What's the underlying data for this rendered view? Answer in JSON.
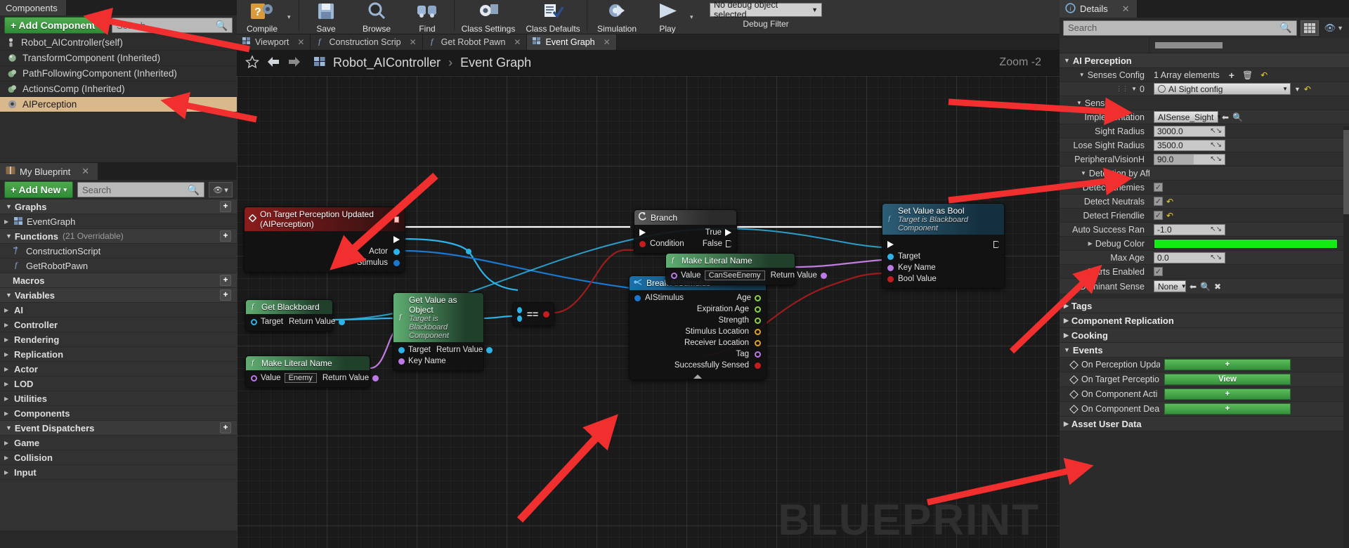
{
  "toolbar": {
    "items": [
      {
        "label": "Compile",
        "icon": "compile-icon"
      },
      {
        "label": "Save",
        "icon": "save-icon"
      },
      {
        "label": "Browse",
        "icon": "browse-icon"
      },
      {
        "label": "Find",
        "icon": "find-icon"
      },
      {
        "label": "Class Settings",
        "icon": "class-settings-icon"
      },
      {
        "label": "Class Defaults",
        "icon": "class-defaults-icon"
      },
      {
        "label": "Simulation",
        "icon": "simulation-icon"
      },
      {
        "label": "Play",
        "icon": "play-icon"
      }
    ],
    "debug_value": "No debug object selected",
    "debug_label": "Debug Filter"
  },
  "components_panel": {
    "tab_label": "Components",
    "add_button": "+ Add Component",
    "add_caret": "▾",
    "search_placeholder": "Search",
    "items": [
      {
        "label": "Robot_AIController(self)",
        "icon": "controller-icon",
        "selected": false
      },
      {
        "label": "TransformComponent (Inherited)",
        "icon": "sphere-icon",
        "selected": false
      },
      {
        "label": "PathFollowingComponent (Inherited)",
        "icon": "sphere-icon",
        "selected": false
      },
      {
        "label": "ActionsComp (Inherited)",
        "icon": "sphere-icon",
        "selected": false
      },
      {
        "label": "AIPerception",
        "icon": "perception-icon",
        "selected": true
      }
    ]
  },
  "my_blueprint": {
    "tab_label": "My Blueprint",
    "tab_icon": "book-icon",
    "add_button": "+ Add New",
    "add_caret": "▾",
    "search_placeholder": "Search",
    "sections": [
      {
        "type": "category",
        "label": "Graphs",
        "has_plus": true
      },
      {
        "type": "item",
        "label": "EventGraph",
        "icon": "graph-icon",
        "expandable": true
      },
      {
        "type": "category",
        "label": "Functions",
        "sub": "(21 Overridable)",
        "has_plus": true
      },
      {
        "type": "item",
        "label": "ConstructionScript",
        "icon": "function-construction-icon",
        "expandable": false
      },
      {
        "type": "item",
        "label": "GetRobotPawn",
        "icon": "function-icon",
        "expandable": false
      },
      {
        "type": "category",
        "label": "Macros",
        "has_plus": true
      },
      {
        "type": "category",
        "label": "Variables",
        "has_plus": true
      },
      {
        "type": "item",
        "label": "AI",
        "expandable": true,
        "bold": true
      },
      {
        "type": "item",
        "label": "Controller",
        "expandable": true,
        "bold": true
      },
      {
        "type": "item",
        "label": "Rendering",
        "expandable": true,
        "bold": true
      },
      {
        "type": "item",
        "label": "Replication",
        "expandable": true,
        "bold": true
      },
      {
        "type": "item",
        "label": "Actor",
        "expandable": true,
        "bold": true
      },
      {
        "type": "item",
        "label": "LOD",
        "expandable": true,
        "bold": true
      },
      {
        "type": "item",
        "label": "Utilities",
        "expandable": true,
        "bold": true
      },
      {
        "type": "item",
        "label": "Components",
        "expandable": true,
        "bold": true
      },
      {
        "type": "category",
        "label": "Event Dispatchers",
        "has_plus": true
      },
      {
        "type": "item",
        "label": "Game",
        "expandable": true,
        "bold": true
      },
      {
        "type": "item",
        "label": "Collision",
        "expandable": true,
        "bold": true
      },
      {
        "type": "item",
        "label": "Input",
        "expandable": true,
        "bold": true
      }
    ]
  },
  "graph": {
    "tabs": [
      {
        "label": "Viewport",
        "icon": "viewport-icon",
        "active": false,
        "closable": true
      },
      {
        "label": "Construction Scrip",
        "icon": "function-icon",
        "active": false,
        "closable": true
      },
      {
        "label": "Get Robot Pawn",
        "icon": "function-icon",
        "active": false,
        "closable": true
      },
      {
        "label": "Event Graph",
        "icon": "graph-icon",
        "active": true,
        "closable": true
      }
    ],
    "breadcrumb_root": "Robot_AIController",
    "breadcrumb_sep": "›",
    "breadcrumb_leaf": "Event Graph",
    "zoom_label": "Zoom  -2",
    "watermark": "BLUEPRINT",
    "nodes": [
      {
        "id": "on-target-perception-updated",
        "title": "On Target Perception Updated (AIPerception)",
        "style": "red",
        "outputs": [
          "Actor",
          "Stimulus"
        ]
      },
      {
        "id": "branch",
        "title": "Branch",
        "style": "grey",
        "inputs": [
          "Condition"
        ],
        "outputs": [
          "True",
          "False"
        ]
      },
      {
        "id": "break-aistimulus",
        "title": "Break AIStimulus",
        "style": "blue",
        "inputs": [
          "AIStimulus"
        ],
        "outputs": [
          "Age",
          "Expiration Age",
          "Strength",
          "Stimulus Location",
          "Receiver Location",
          "Tag",
          "Successfully Sensed"
        ]
      },
      {
        "id": "get-blackboard",
        "title": "Get Blackboard",
        "style": "green",
        "inputs": [
          "Target"
        ],
        "outputs": [
          "Return Value"
        ]
      },
      {
        "id": "get-value-as-object",
        "title": "Get Value as Object",
        "subtitle": "Target is Blackboard Component",
        "style": "green",
        "inputs": [
          "Target",
          "Key Name"
        ],
        "outputs": [
          "Return Value"
        ]
      },
      {
        "id": "make-literal-name-enemy",
        "title": "Make Literal Name",
        "style": "green",
        "inputs": [
          "Value"
        ],
        "value": "Enemy",
        "outputs": [
          "Return Value"
        ]
      },
      {
        "id": "make-literal-name-canseeenemy",
        "title": "Make Literal Name",
        "style": "green",
        "inputs": [
          "Value"
        ],
        "value": "CanSeeEnemy",
        "outputs": [
          "Return Value"
        ]
      },
      {
        "id": "equal-compare",
        "title": "==",
        "style": "compare"
      },
      {
        "id": "set-value-as-bool",
        "title": "Set Value as Bool",
        "subtitle": "Target is Blackboard Component",
        "style": "teal",
        "inputs": [
          "Target",
          "Key Name",
          "Bool Value"
        ]
      }
    ]
  },
  "details": {
    "tab_label": "Details",
    "tab_icon": "info-icon",
    "search_placeholder": "Search",
    "categories": {
      "ai_perception": "AI Perception",
      "tags": "Tags",
      "component_replication": "Component Replication",
      "cooking": "Cooking",
      "events": "Events",
      "asset_user_data": "Asset User Data"
    },
    "rows": [
      {
        "label": "Senses Config",
        "value": "1 Array elements",
        "type": "array",
        "indent": 0
      },
      {
        "label": "0",
        "value": "AI Sight config",
        "type": "combo-object",
        "indent": 1
      },
      {
        "label": "Sense",
        "type": "subheader",
        "indent": 2
      },
      {
        "label": "Implementation",
        "value": "AISense_Sight",
        "type": "combo",
        "indent": 3
      },
      {
        "label": "Sight Radius",
        "value": "3000.0",
        "type": "number",
        "indent": 3
      },
      {
        "label": "Lose Sight Radius",
        "value": "3500.0",
        "type": "number",
        "indent": 3
      },
      {
        "label": "PeripheralVisionH",
        "value": "90.0",
        "type": "number-slider",
        "indent": 3
      },
      {
        "label": "Detection by Affili",
        "type": "subheader",
        "indent": 3
      },
      {
        "label": "Detect Enemies",
        "value": "checked",
        "type": "checkbox",
        "indent": 4
      },
      {
        "label": "Detect Neutrals",
        "value": "checked",
        "type": "checkbox-reset",
        "indent": 4
      },
      {
        "label": "Detect Friendlie",
        "value": "checked",
        "type": "checkbox-reset",
        "indent": 4
      },
      {
        "label": "Auto Success Ran",
        "value": "-1.0",
        "type": "number",
        "indent": 4
      },
      {
        "label": "Debug Color",
        "value": "#12ec12",
        "type": "color",
        "indent": 3
      },
      {
        "label": "Max Age",
        "value": "0.0",
        "type": "number",
        "indent": 3
      },
      {
        "label": "Starts Enabled",
        "value": "checked",
        "type": "checkbox",
        "indent": 3
      },
      {
        "label": "Dominant Sense",
        "value": "None",
        "type": "combo-small",
        "indent": 0
      }
    ],
    "events": [
      {
        "label": "On Perception Upda",
        "button": "+"
      },
      {
        "label": "On Target Perceptio",
        "button": "View"
      },
      {
        "label": "On Component Acti",
        "button": "+"
      },
      {
        "label": "On Component Dea",
        "button": "+"
      }
    ],
    "accent": "#12ec12"
  },
  "annotations": {
    "arrow_color": "#f22f2f",
    "count": 7
  }
}
